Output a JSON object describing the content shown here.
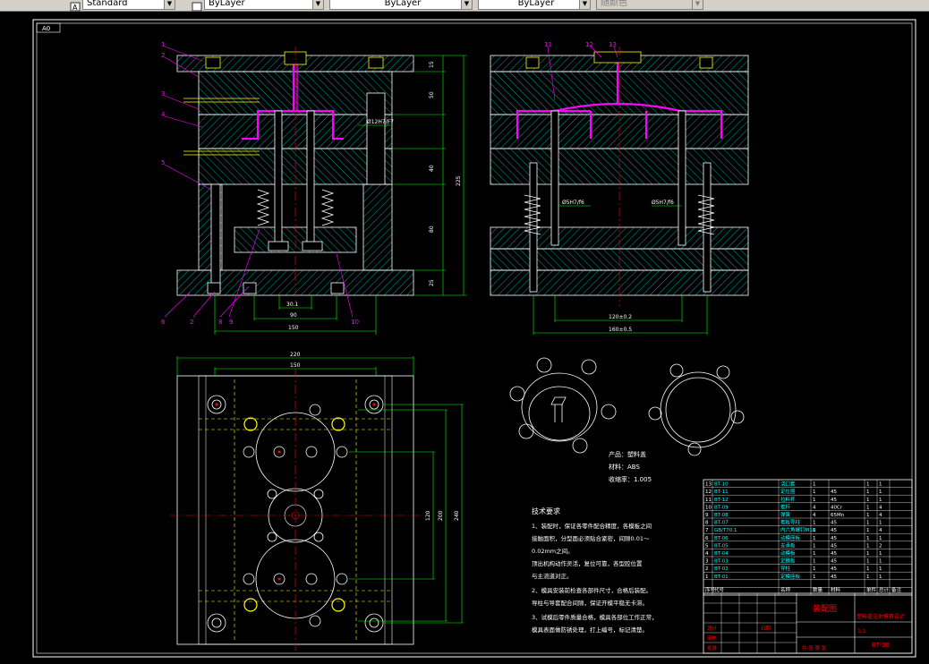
{
  "toolbar": {
    "text_style": "Standard",
    "layer_color": "ByLayer",
    "linetype": "ByLayer",
    "lineweight": "ByLayer",
    "plot_style": "随颜色"
  },
  "drawing": {
    "sheet_size": "A0",
    "top_view_callouts_left": [
      "1",
      "2",
      "3",
      "4",
      "5"
    ],
    "bottom_callouts": [
      "6",
      "2",
      "8",
      "9",
      "10"
    ],
    "side_view_callouts": [
      "11",
      "12",
      "13"
    ],
    "front_dims": {
      "h1": "15",
      "h2": "50",
      "h3": "40",
      "h4": "80",
      "h5": "25",
      "total_h": "225",
      "bore": "Ø12H7/F7",
      "w1": "30.1",
      "w2": "90",
      "w3": "150"
    },
    "side_dims": {
      "pin1": "Ø5H7/f6",
      "pin2": "Ø5H7/f6",
      "w1": "120±0.2",
      "w2": "160±0.5"
    },
    "plan_dims": {
      "w_top": "220",
      "w_inner": "150",
      "h_inner": "120",
      "h_mid": "200",
      "h_total": "240"
    },
    "product": {
      "name": "产品：塑料盖",
      "material": "材料：ABS",
      "shrink": "收缩率：1.005"
    },
    "tech_req": {
      "title": "技术要求",
      "lines": [
        "1、装配时，保证各零件配合精度，各模板之间",
        "接触面积，分型面必须贴合紧密，间隙0.01～",
        "0.02mm之间。",
        "顶出机构动作灵活，复位可靠，各型腔位置",
        "与主流道对正。",
        "2、模具安装前检查各部件尺寸，合格后装配。",
        "导柱与导套配合间隙，保证开模平稳无卡滞。",
        "3、试模后零件质量合格，模具各部位工作正常，",
        "模具表面做防锈处理，打上编号，标记清楚。"
      ]
    },
    "bom": [
      {
        "no": "13",
        "code": "BT-10",
        "name": "浇口套",
        "qty": "1",
        "mat": "",
        "a": "1",
        "b": "1"
      },
      {
        "no": "12",
        "code": "BT-11",
        "name": "定位圈",
        "qty": "1",
        "mat": "45",
        "a": "1",
        "b": "1"
      },
      {
        "no": "11",
        "code": "BT-12",
        "name": "拉料杆",
        "qty": "1",
        "mat": "45",
        "a": "1",
        "b": "1"
      },
      {
        "no": "10",
        "code": "BT-09",
        "name": "推杆",
        "qty": "4",
        "mat": "40Cr",
        "a": "1",
        "b": "4"
      },
      {
        "no": "9",
        "code": "BT-08",
        "name": "弹簧",
        "qty": "4",
        "mat": "65Mn",
        "a": "1",
        "b": "4"
      },
      {
        "no": "8",
        "code": "BT-07",
        "name": "推板导柱",
        "qty": "1",
        "mat": "45",
        "a": "1",
        "b": "1"
      },
      {
        "no": "7",
        "code": "GB/T70.1",
        "name": "内六角螺钉M10",
        "qty": "1",
        "mat": "45",
        "a": "1",
        "b": "4"
      },
      {
        "no": "6",
        "code": "BT-06",
        "name": "动模座板",
        "qty": "1",
        "mat": "45",
        "a": "1",
        "b": "1"
      },
      {
        "no": "5",
        "code": "BT-05",
        "name": "支承板",
        "qty": "1",
        "mat": "45",
        "a": "1",
        "b": "2"
      },
      {
        "no": "4",
        "code": "BT-04",
        "name": "动模板",
        "qty": "1",
        "mat": "45",
        "a": "1",
        "b": "1"
      },
      {
        "no": "3",
        "code": "BT-03",
        "name": "定模板",
        "qty": "1",
        "mat": "45",
        "a": "1",
        "b": "1"
      },
      {
        "no": "2",
        "code": "BT-02",
        "name": "导柱",
        "qty": "1",
        "mat": "45",
        "a": "1",
        "b": "1"
      },
      {
        "no": "1",
        "code": "BT-01",
        "name": "定模座板",
        "qty": "1",
        "mat": "45",
        "a": "1",
        "b": "1"
      }
    ],
    "bom_header": {
      "no": "序号",
      "code": "代号",
      "name": "名称",
      "qty": "数量",
      "mat": "材料",
      "a": "单件",
      "b": "总计",
      "note": "备注"
    },
    "title_block": {
      "title": "装配图",
      "subtitle": "塑料盖注射模具设计",
      "drawing_no": "BT-00",
      "scale": "1:1",
      "designer": "设计",
      "checker": "审核",
      "approver": "批准",
      "date": "日期",
      "sheet": "共 张 第 张"
    }
  }
}
